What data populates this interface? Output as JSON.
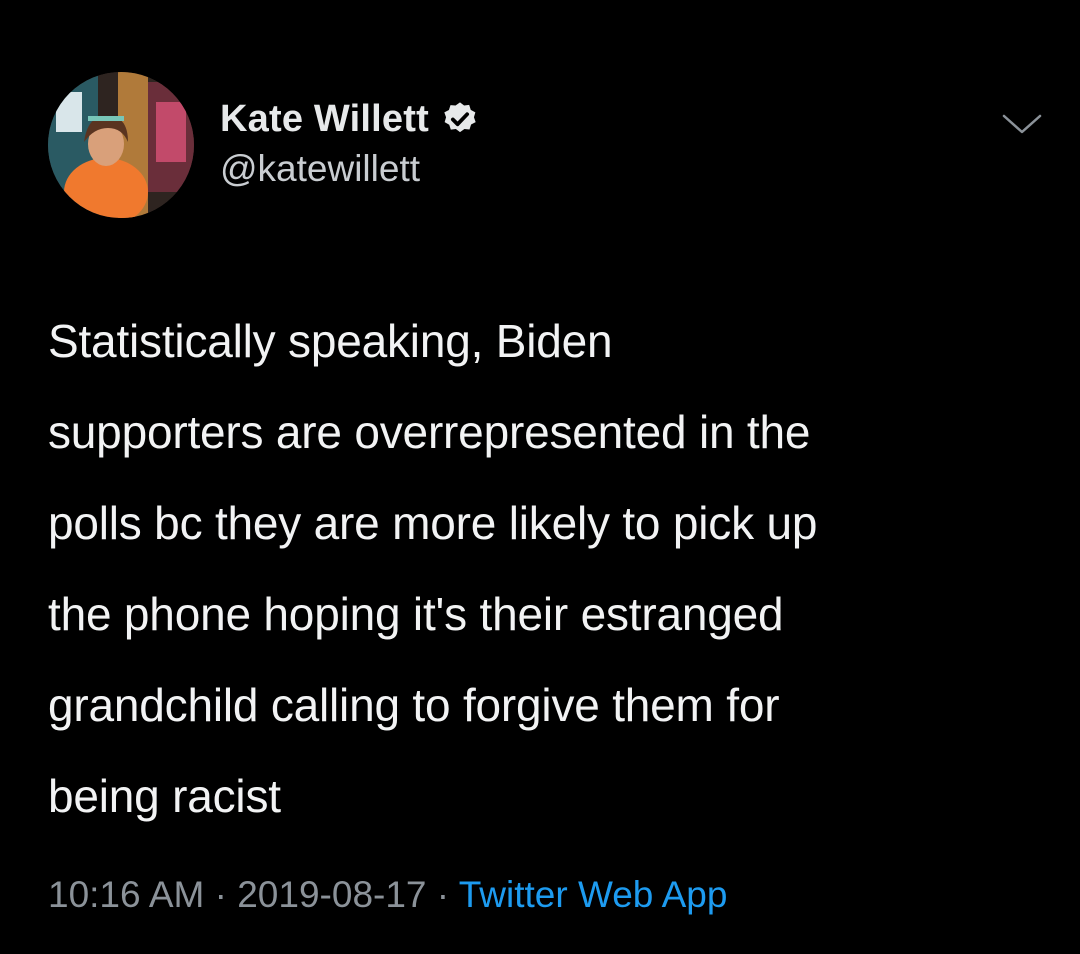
{
  "tweet": {
    "author": {
      "display_name": "Kate Willett",
      "handle": "@katewillett",
      "verified_icon": "verified-badge-icon"
    },
    "menu_icon": "chevron-down-icon",
    "text_lines": [
      "Statistically speaking, Biden",
      "supporters are overrepresented in the",
      "polls bc they are more likely to pick up",
      "the phone hoping it's their estranged",
      "grandchild calling to forgive them for",
      "being racist"
    ],
    "time": "10:16 AM",
    "separator": "·",
    "date": "2019-08-17",
    "source": "Twitter Web App"
  },
  "colors": {
    "background": "#000000",
    "link": "#1d9bf0",
    "muted": "#8b9299",
    "text": "#f2f3f4"
  }
}
